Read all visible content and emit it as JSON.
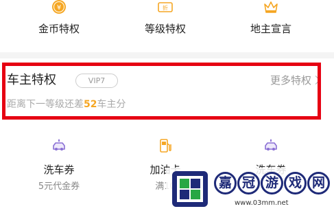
{
  "top_row": {
    "items": [
      {
        "label": "金币特权",
        "icon": "coin-icon",
        "icon_glyph": "¥"
      },
      {
        "label": "等级特权",
        "icon": "discount-ticket-icon",
        "icon_glyph": "折"
      },
      {
        "label": "地主宣言",
        "icon": "crown-icon",
        "icon_glyph": ""
      }
    ]
  },
  "privilege": {
    "title": "车主特权",
    "badge": "VIP7",
    "more": "更多特权",
    "progress_prefix": "距离下一等级还差",
    "progress_value": "52",
    "progress_suffix": "车主分"
  },
  "services": [
    {
      "title": "洗车券",
      "sub": "5元代金券",
      "icon": "car-wash-icon"
    },
    {
      "title": "加油卡",
      "sub": "满10",
      "icon": "fuel-pump-icon"
    },
    {
      "title": "洗车券",
      "sub": "",
      "icon": "car-wash-icon"
    }
  ],
  "watermark": {
    "chars": [
      "嘉",
      "冠",
      "游",
      "戏",
      "网"
    ],
    "url": "www.03mm.net"
  },
  "colors": {
    "gold": "#f5a623",
    "purple": "#8a6fd4",
    "highlight_red": "#e60012",
    "watermark_navy": "#1e2a78"
  }
}
